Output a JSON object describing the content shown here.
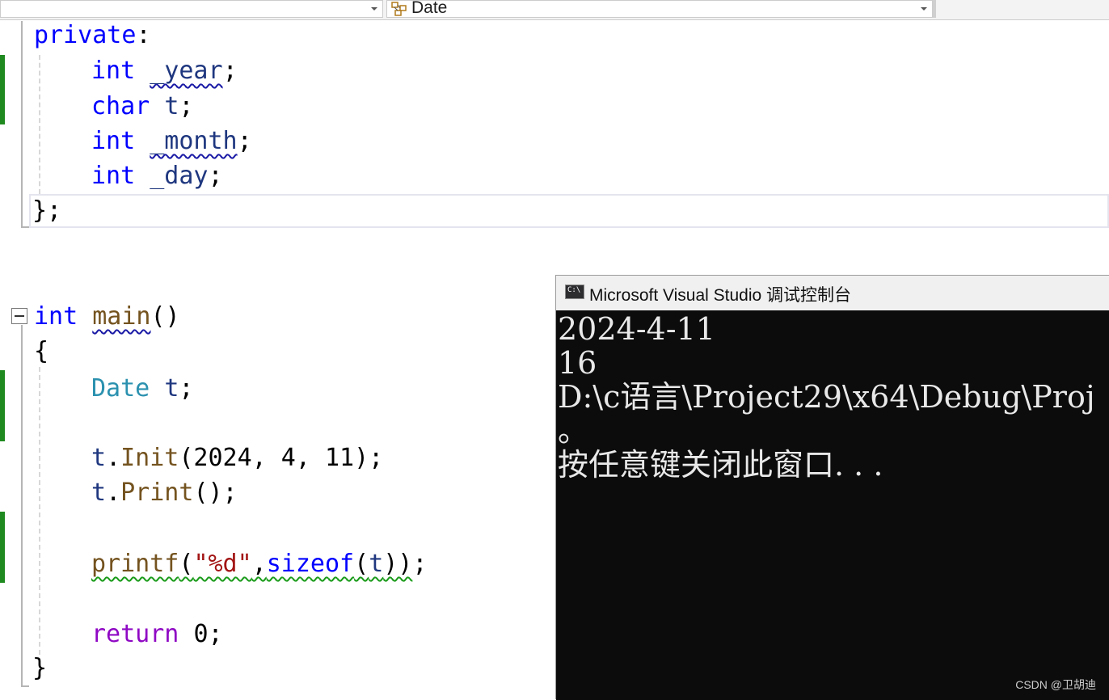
{
  "nav": {
    "scope_dropdown": "",
    "member_dropdown": "Date"
  },
  "editor": {
    "lines": {
      "l1_kw": "private",
      "l1_colon": ":",
      "l2_type": "int",
      "l2_name": "_year",
      "l2_end": ";",
      "l3_type": "char",
      "l3_name": "t",
      "l3_end": ";",
      "l4_type": "int",
      "l4_name": "_month",
      "l4_end": ";",
      "l5_type": "int",
      "l5_name": "_day",
      "l5_end": ";",
      "l6": "};",
      "m1_type": "int",
      "m1_name": "main",
      "m1_parens": "()",
      "m2": "{",
      "m3_type": "Date",
      "m3_var": "t",
      "m3_end": ";",
      "m4_var": "t",
      "m4_dot": ".",
      "m4_fn": "Init",
      "m4_args": "(2024, 4, 11);",
      "m5_var": "t",
      "m5_dot": ".",
      "m5_fn": "Print",
      "m5_end": "();",
      "m6_fn": "printf",
      "m6_open": "(",
      "m6_str": "\"%d\"",
      "m6_comma": ",",
      "m6_kw": "sizeof",
      "m6_open2": "(",
      "m6_var": "t",
      "m6_close": "))",
      "m6_end": ";",
      "m7_kw": "return",
      "m7_val": "0;",
      "m8": "}"
    }
  },
  "console": {
    "title": "Microsoft Visual Studio 调试控制台",
    "output": [
      "2024-4-11",
      "16",
      "D:\\c语言\\Project29\\x64\\Debug\\Proj",
      "。",
      "按任意键关闭此窗口. . ."
    ]
  },
  "watermark": "CSDN @卫胡迪"
}
